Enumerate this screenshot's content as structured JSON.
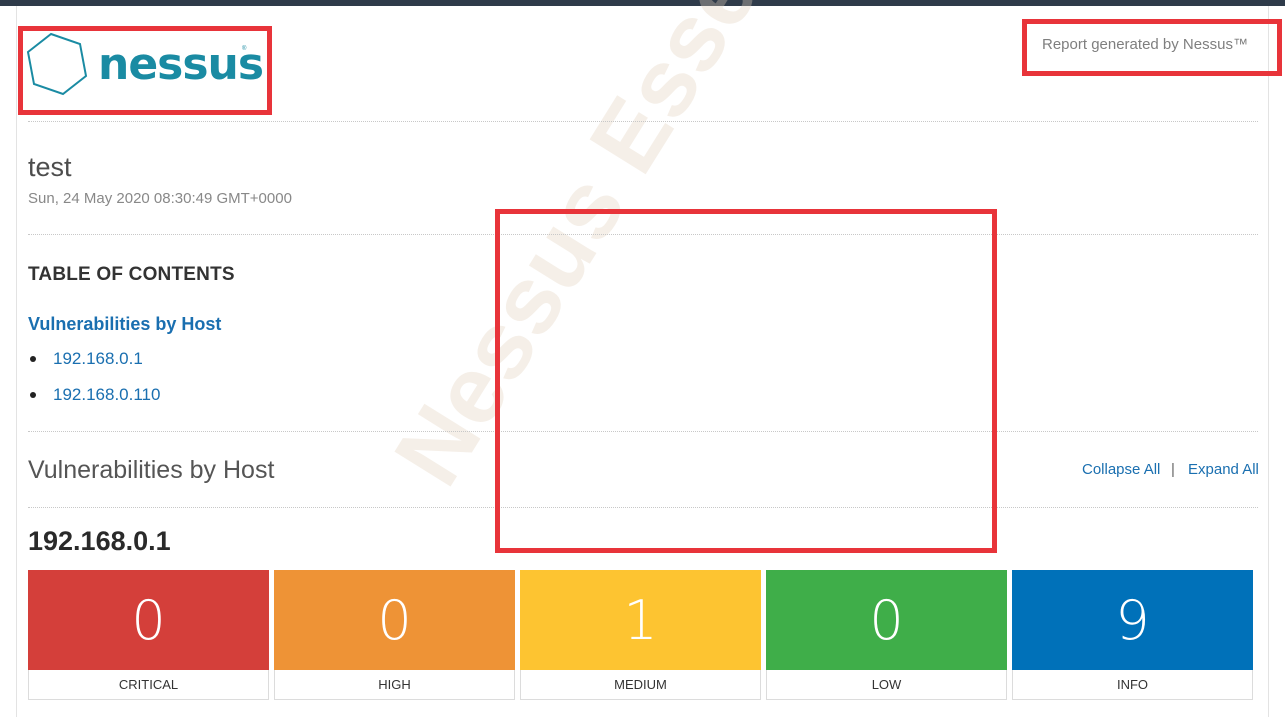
{
  "logo": {
    "text": "nessus",
    "tm": "®"
  },
  "header": {
    "report_generated": "Report generated by Nessus™"
  },
  "scan": {
    "title": "test",
    "date": "Sun, 24 May 2020 08:30:49 GMT+0000"
  },
  "toc": {
    "heading": "TABLE OF CONTENTS",
    "section": "Vulnerabilities by Host",
    "hosts": [
      "192.168.0.1",
      "192.168.0.110"
    ]
  },
  "vulns": {
    "title": "Vulnerabilities by Host",
    "collapse_label": "Collapse All",
    "separator": "|",
    "expand_label": "Expand All"
  },
  "host": {
    "name": "192.168.0.1",
    "severity": [
      {
        "label": "CRITICAL",
        "count": "0",
        "color": "#d43f3a"
      },
      {
        "label": "HIGH",
        "count": "0",
        "color": "#ee9336"
      },
      {
        "label": "MEDIUM",
        "count": "1",
        "color": "#fdc431"
      },
      {
        "label": "LOW",
        "count": "0",
        "color": "#3fae49"
      },
      {
        "label": "INFO",
        "count": "9",
        "color": "#0071b9"
      }
    ]
  },
  "watermark": "Nessus Essentials",
  "colors": {
    "accent": "#1a6fb0",
    "brand": "#1a8ba3",
    "highlight_box": "#e8343a"
  }
}
